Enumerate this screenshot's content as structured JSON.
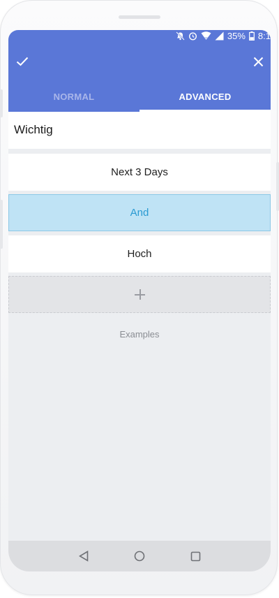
{
  "status_bar": {
    "battery_percent": "35%",
    "time": "8:1"
  },
  "icons": {
    "check": "check-icon",
    "close": "close-icon",
    "add": "plus-icon",
    "nav_back": "triangle-back-icon",
    "nav_home": "circle-home-icon",
    "nav_recents": "square-recents-icon"
  },
  "colors": {
    "app_bar": "#5a77d7",
    "and_highlight": "#bfe3f5",
    "and_text": "#2a9ad2"
  },
  "tabs": [
    {
      "label": "NORMAL",
      "selected": false
    },
    {
      "label": "ADVANCED",
      "selected": true
    }
  ],
  "filter_name": {
    "value": "Wichtig"
  },
  "filters": {
    "first": "Next 3 Days",
    "operator": "And",
    "second": "Hoch"
  },
  "examples_label": "Examples"
}
